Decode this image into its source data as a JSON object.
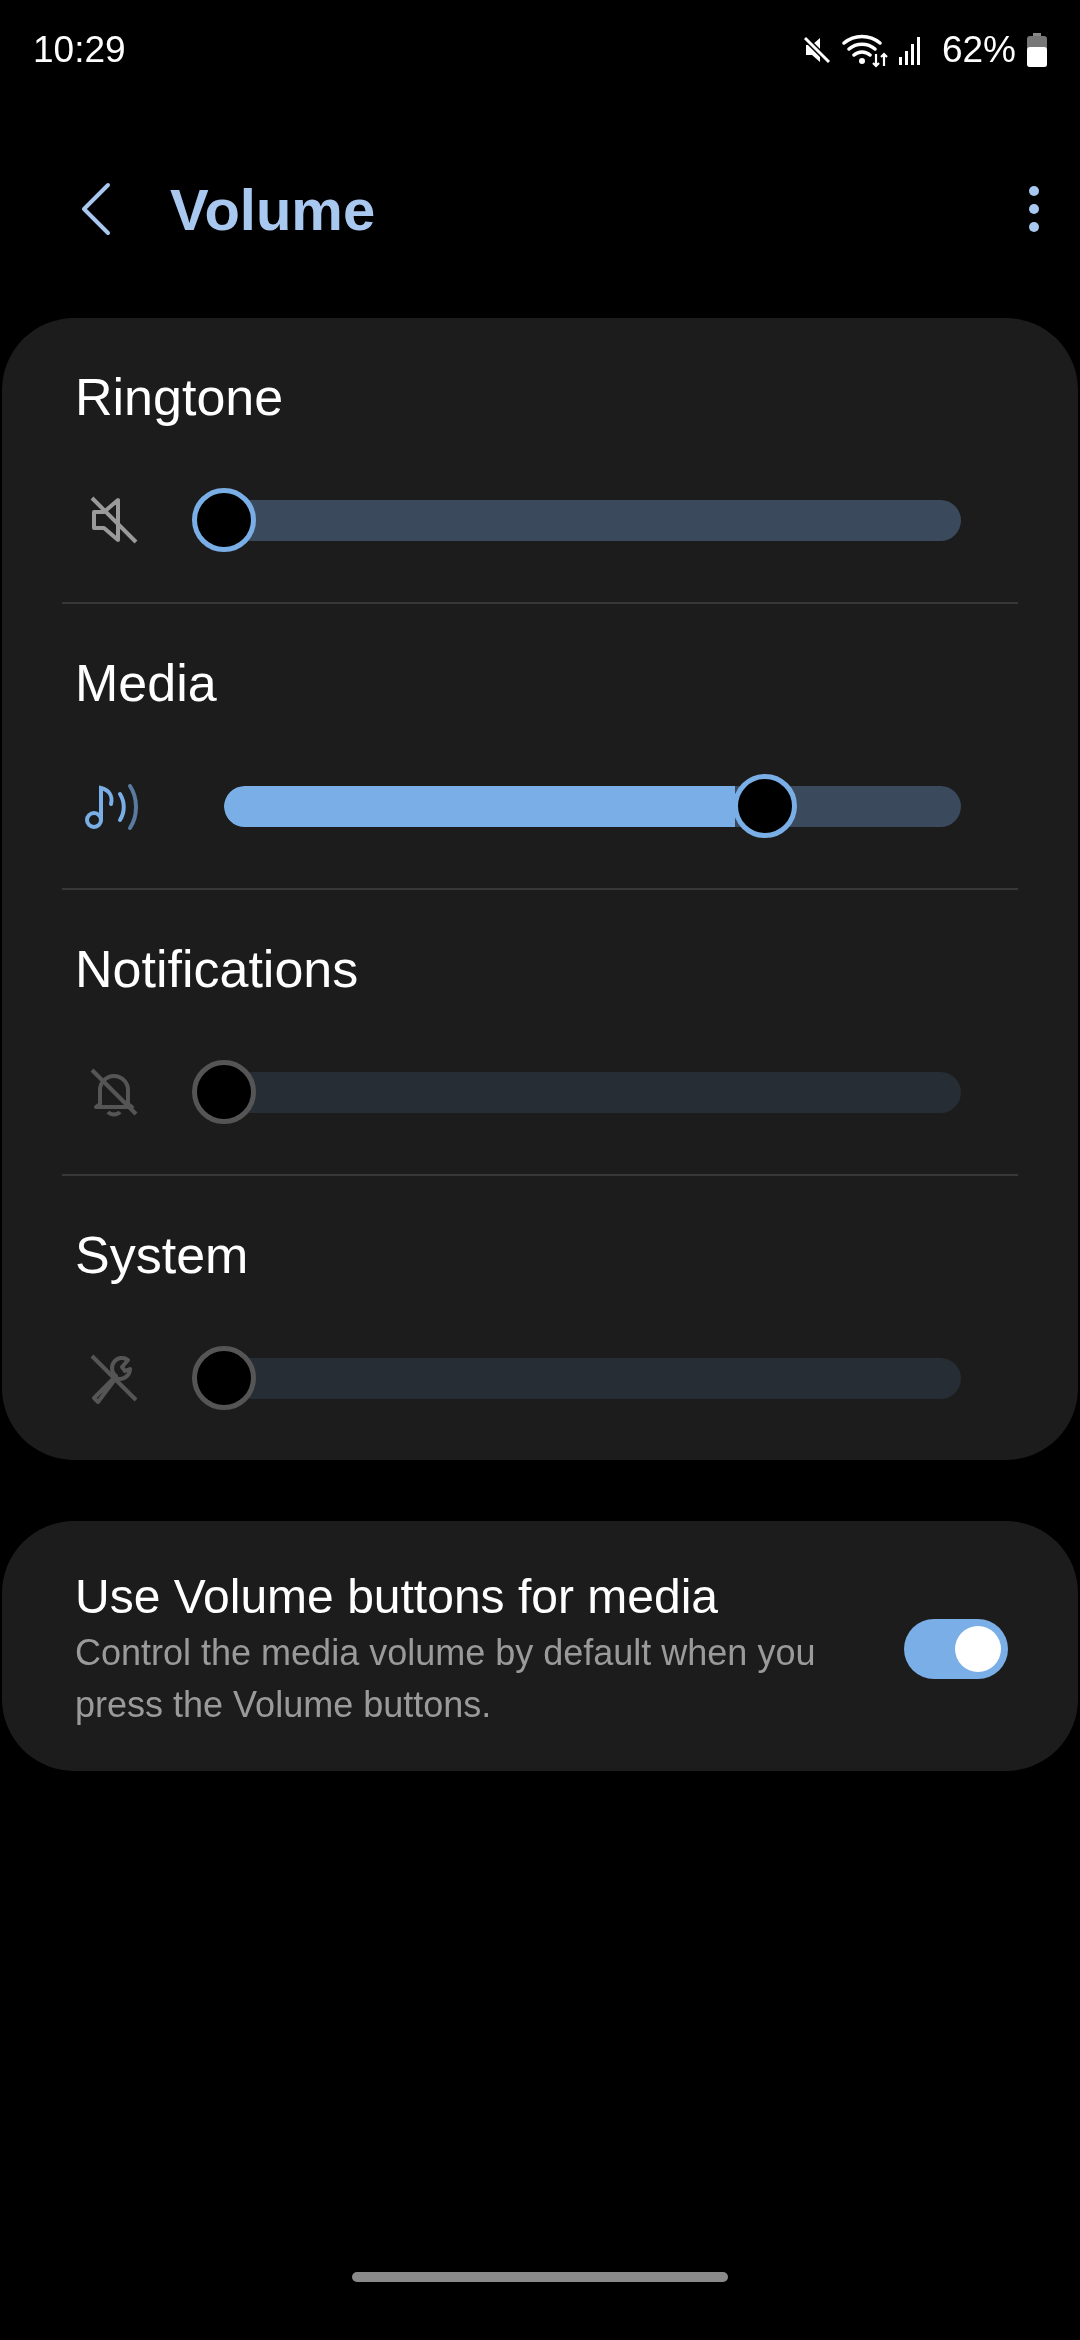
{
  "status_bar": {
    "time": "10:29",
    "battery": "62%"
  },
  "header": {
    "title": "Volume"
  },
  "volume_sliders": [
    {
      "label": "Ringtone",
      "level": 0,
      "disabled": false
    },
    {
      "label": "Media",
      "level": 0.734,
      "disabled": false
    },
    {
      "label": "Notifications",
      "level": 0,
      "disabled": true
    },
    {
      "label": "System",
      "level": 0,
      "disabled": true
    }
  ],
  "media_keys": {
    "title": "Use Volume buttons for media",
    "subtitle": "Control the media volume by default when you press the Volume buttons.",
    "on": true
  }
}
